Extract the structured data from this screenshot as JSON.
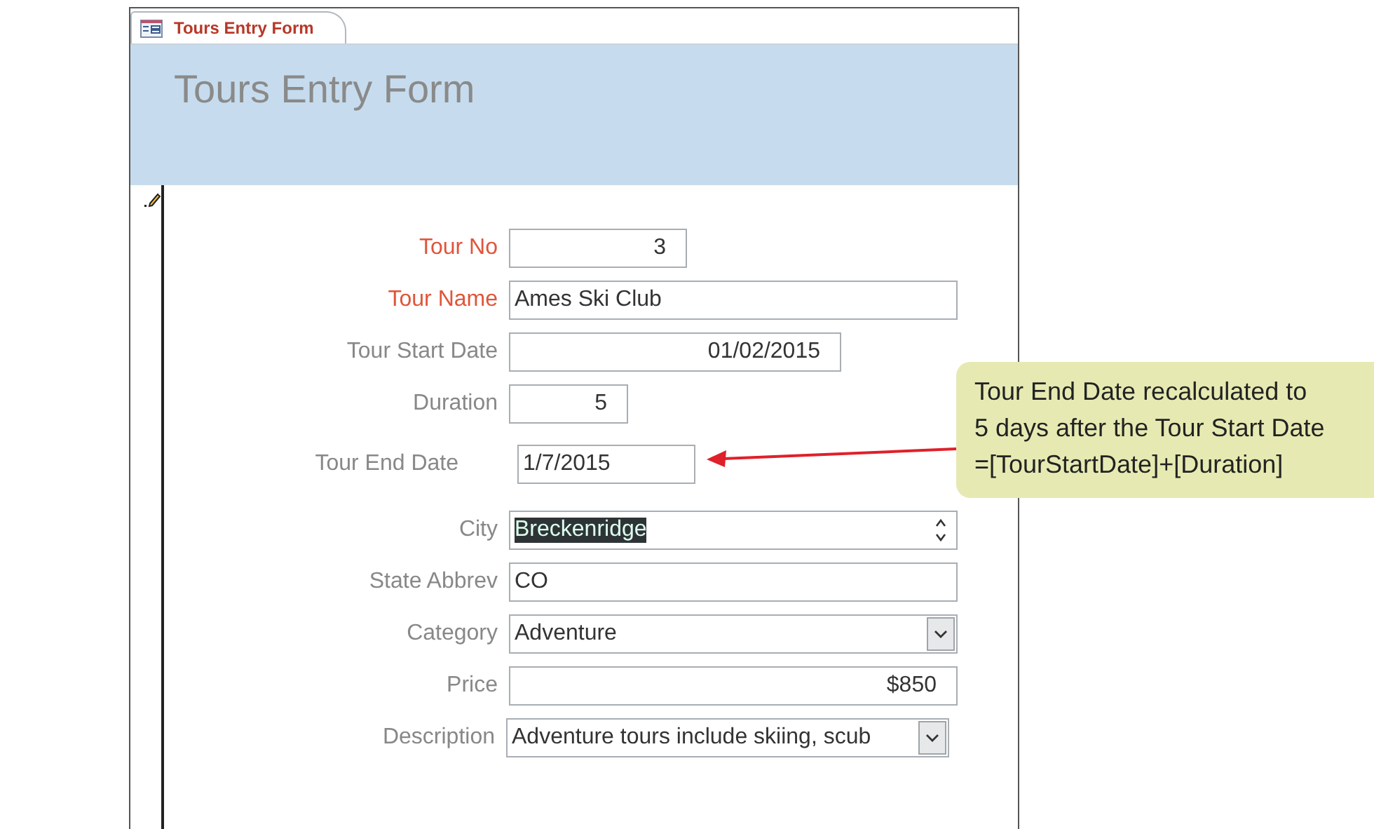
{
  "tab": {
    "label": "Tours Entry Form",
    "selected": true
  },
  "header": {
    "title": "Tours Entry Form"
  },
  "fields": [
    {
      "label": "Tour No",
      "value": "3",
      "kind": "number",
      "required": true,
      "selected": false
    },
    {
      "label": "Tour Name",
      "value": "Ames Ski Club",
      "kind": "text",
      "required": true,
      "selected": false
    },
    {
      "label": "Tour Start Date",
      "value": "01/02/2015",
      "kind": "number",
      "required": false,
      "selected": false
    },
    {
      "label": "Duration",
      "value": "5",
      "kind": "number",
      "required": false,
      "selected": false
    },
    {
      "label": "Tour End Date",
      "value": "1/7/2015",
      "kind": "text",
      "required": false,
      "selected": false
    },
    {
      "label": "City",
      "value": "Breckenridge",
      "kind": "spin",
      "required": false,
      "selected": true
    },
    {
      "label": "State Abbrev",
      "value": "CO",
      "kind": "text",
      "required": false,
      "selected": false
    },
    {
      "label": "Category",
      "value": "Adventure",
      "kind": "combo",
      "required": false,
      "selected": false
    },
    {
      "label": "Price",
      "value": "$850",
      "kind": "number",
      "required": false,
      "selected": false
    },
    {
      "label": "Description",
      "value": "Adventure tours include skiing, scub",
      "kind": "combo",
      "required": false,
      "selected": false
    }
  ],
  "callout": {
    "lines": [
      "Tour End Date recalculated to",
      "5 days after the Tour Start Date",
      "=[TourStartDate]+[Duration]"
    ]
  }
}
